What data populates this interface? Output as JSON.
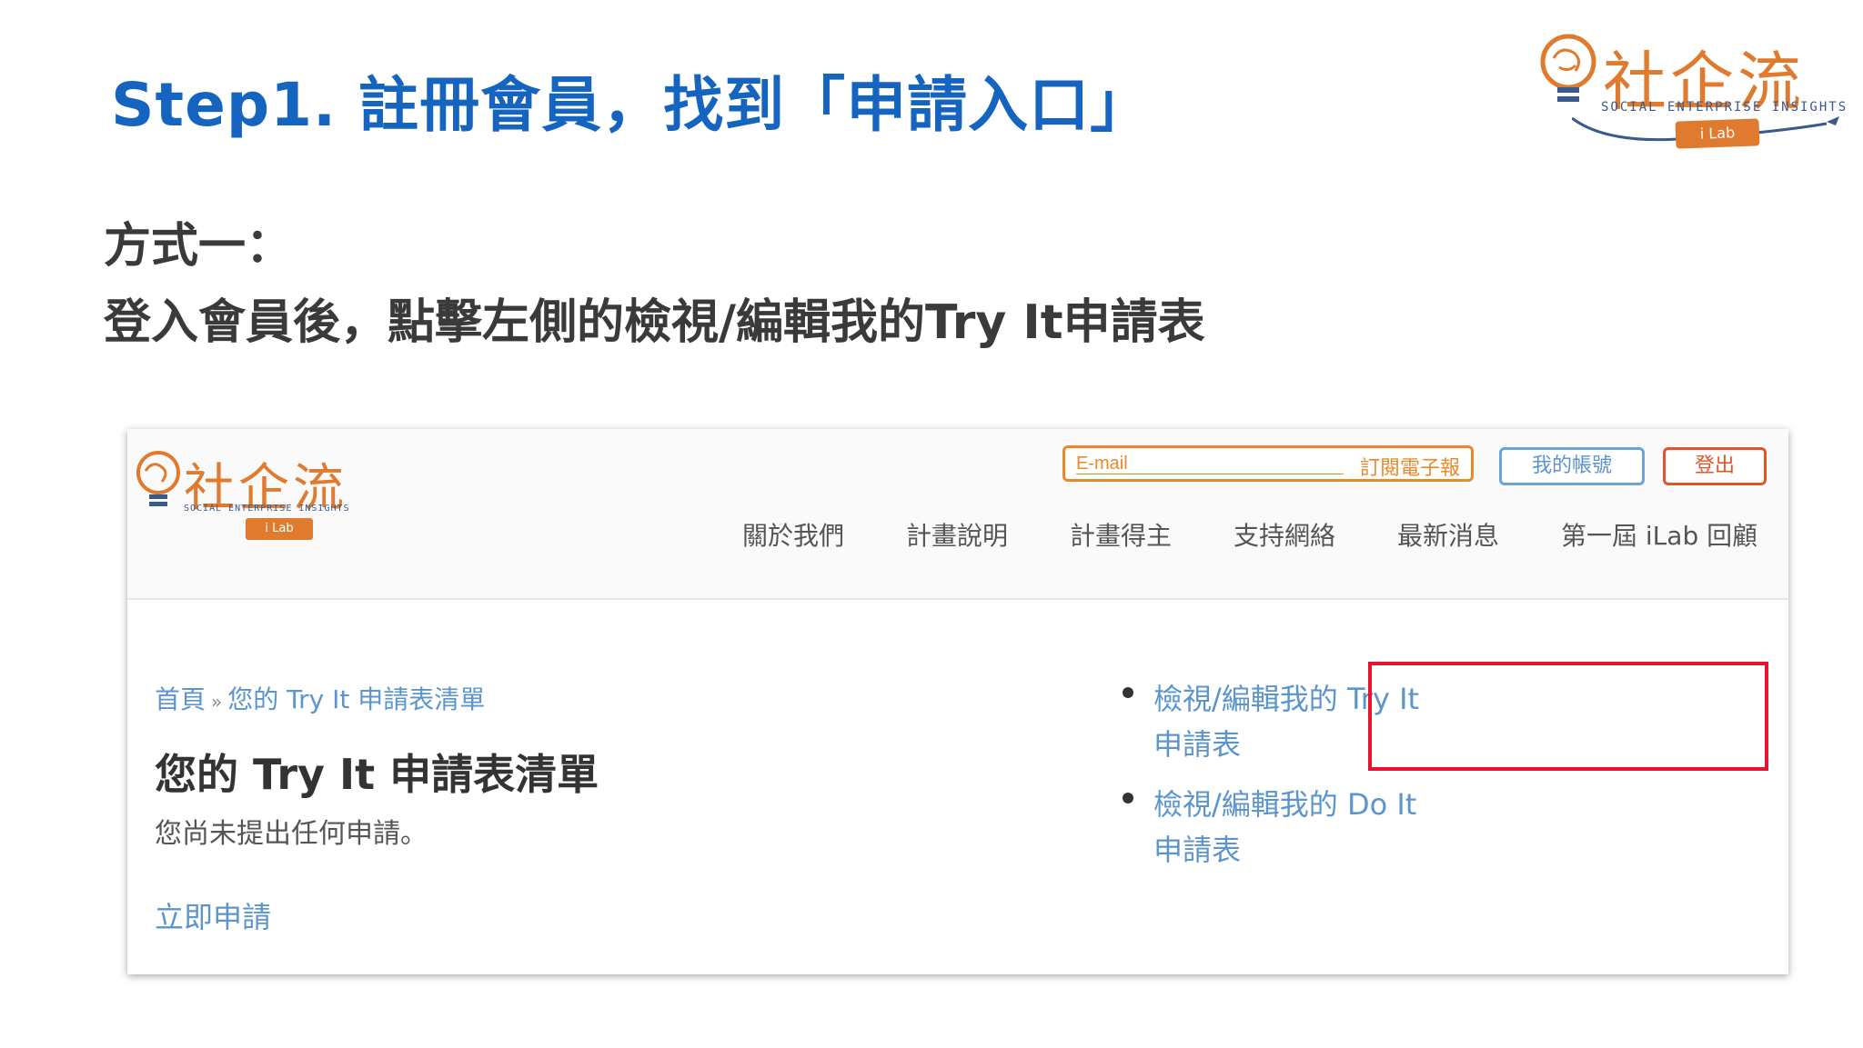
{
  "slide": {
    "title": "Step1. 註冊會員，找到「申請入口」",
    "method_heading": "方式一：",
    "method_description": "登入會員後，點擊左側的檢視/編輯我的Try It申請表"
  },
  "brand": {
    "name": "社企流",
    "subtitle": "SOCIAL ENTERPRISE INSIGHTS",
    "tag": "i Lab"
  },
  "site": {
    "logo": {
      "name": "社企流",
      "subtitle": "SOCIAL ENTERPRISE INSIGHTS",
      "tag": "i Lab"
    },
    "newsletter": {
      "placeholder": "E-mail",
      "button_label": "訂閱電子報"
    },
    "account_button": "我的帳號",
    "logout_button": "登出",
    "nav": [
      "關於我們",
      "計畫說明",
      "計畫得主",
      "支持網絡",
      "最新消息",
      "第一屆 iLab 回顧"
    ],
    "breadcrumb": {
      "home": "首頁",
      "separator": "»",
      "current": "您的 Try It 申請表清單"
    },
    "page_heading": "您的 Try It 申請表清單",
    "empty_note": "您尚未提出任何申請。",
    "apply_link": "立即申請",
    "side_links": [
      {
        "label": "檢視/編輯我的 Try It 申請表"
      },
      {
        "label": "檢視/編輯我的 Do It 申請表"
      }
    ]
  },
  "colors": {
    "title_blue": "#1565c0",
    "brand_orange": "#e07a2e",
    "link_blue": "#5b95cc",
    "highlight_red": "#e8132e"
  }
}
